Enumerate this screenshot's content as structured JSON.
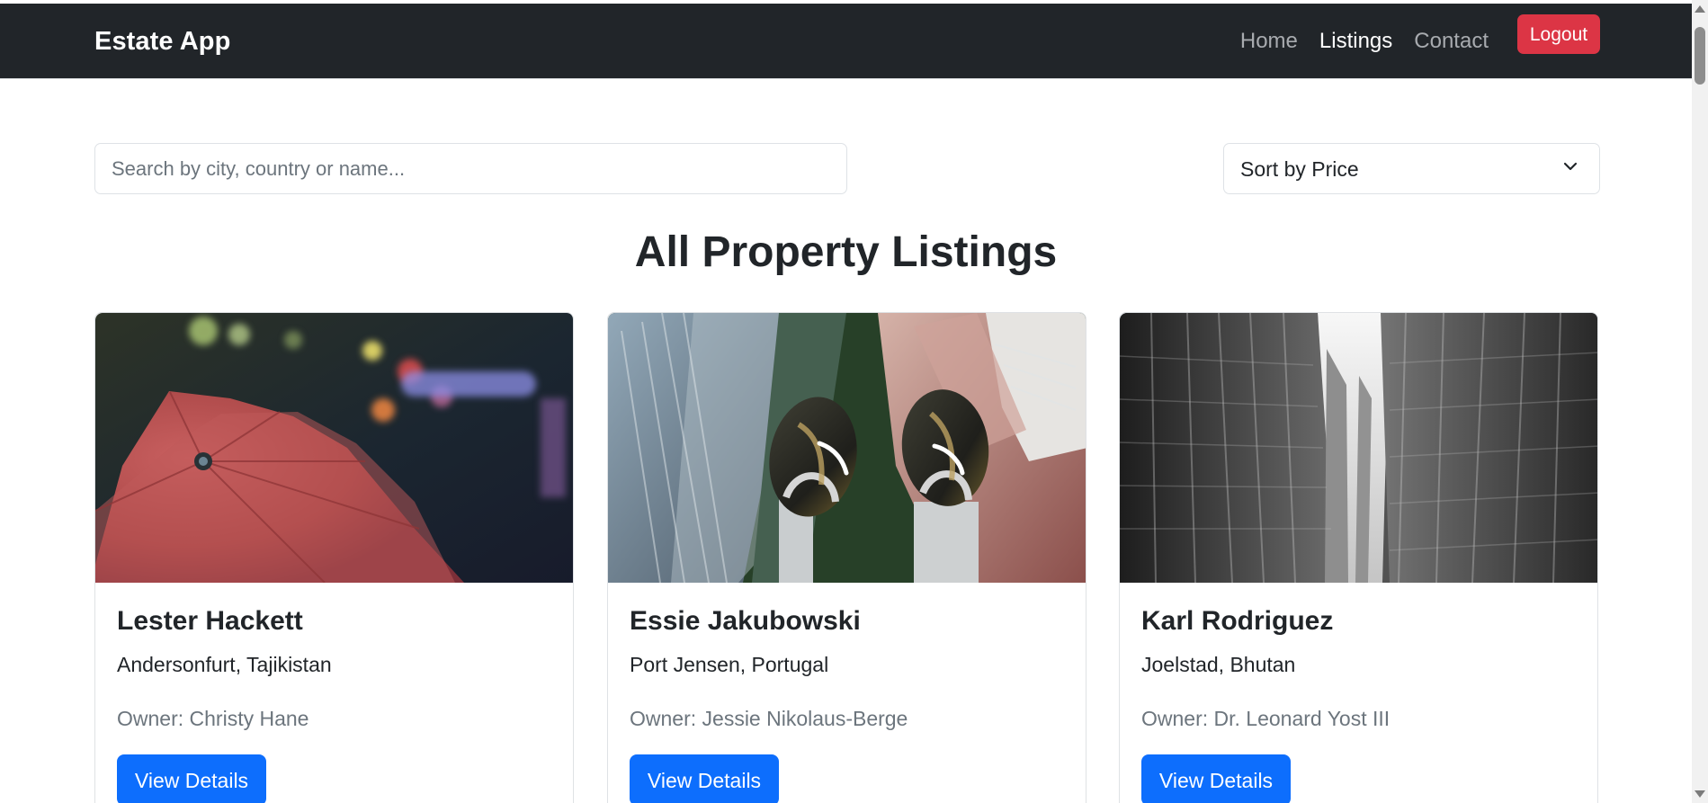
{
  "navbar": {
    "brand": "Estate App",
    "links": [
      "Home",
      "Listings",
      "Contact"
    ],
    "active_link": "Listings",
    "logout_label": "Logout",
    "colors": {
      "background": "#212529",
      "logout": "#dc3545"
    }
  },
  "filters": {
    "search_placeholder": "Search by city, country or name...",
    "sort_value": "Sort by Price"
  },
  "listings_heading": "All Property Listings",
  "cards": [
    {
      "image_icon": "umbrella-photo",
      "title": "Lester Hackett",
      "location": "Andersonfurt, Tajikistan",
      "owner_label": "Owner:",
      "owner_name": "Christy Hane",
      "button_label": "View Details"
    },
    {
      "image_icon": "city-feet-photo",
      "title": "Essie Jakubowski",
      "location": "Port Jensen, Portugal",
      "owner_label": "Owner:",
      "owner_name": "Jessie Nikolaus-Berge",
      "button_label": "View Details"
    },
    {
      "image_icon": "street-buildings-photo",
      "title": "Karl Rodriguez",
      "location": "Joelstad, Bhutan",
      "owner_label": "Owner:",
      "owner_name": "Dr. Leonard Yost III",
      "button_label": "View Details"
    }
  ],
  "colors": {
    "primary_button": "#0d6efd",
    "text": "#212529",
    "muted_text": "#6c757d"
  }
}
